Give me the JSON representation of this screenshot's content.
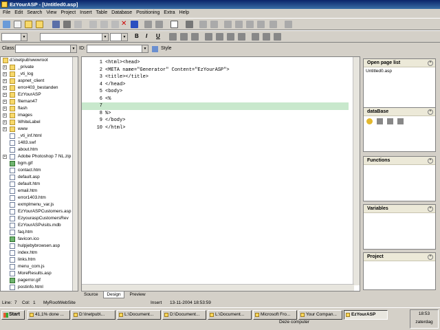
{
  "window": {
    "title": "EzYourASP - [Untitled0.asp]"
  },
  "menu": [
    "File",
    "Edit",
    "Search",
    "View",
    "Project",
    "Insert",
    "Table",
    "Database",
    "Positioning",
    "Extra",
    "Help"
  ],
  "classbar": {
    "class_label": "Class:",
    "id_label": "ID:",
    "style_label": "Style"
  },
  "tree": {
    "root": "d:\\inetpub\\wwwroot",
    "items": [
      {
        "label": "_private",
        "type": "folder",
        "expandable": true
      },
      {
        "label": "_vti_log",
        "type": "folder",
        "expandable": true
      },
      {
        "label": "aspnet_client",
        "type": "folder",
        "expandable": true
      },
      {
        "label": "error403_bestanden",
        "type": "folder",
        "expandable": true
      },
      {
        "label": "EzYourASP",
        "type": "folder",
        "expandable": true
      },
      {
        "label": "fileman47",
        "type": "folder",
        "expandable": true
      },
      {
        "label": "flash",
        "type": "folder",
        "expandable": true
      },
      {
        "label": "images",
        "type": "folder",
        "expandable": true
      },
      {
        "label": "WhiteLabel",
        "type": "folder",
        "expandable": true
      },
      {
        "label": "www",
        "type": "folder",
        "expandable": true
      },
      {
        "label": "_vti_inf.html",
        "type": "file",
        "expandable": false
      },
      {
        "label": "1483.swf",
        "type": "file",
        "expandable": false
      },
      {
        "label": "about.htm",
        "type": "file",
        "expandable": false
      },
      {
        "label": "Adobe Photoshop 7 NL.zip",
        "type": "file",
        "expandable": true
      },
      {
        "label": "bgm.gif",
        "type": "img",
        "expandable": false
      },
      {
        "label": "contact.htm",
        "type": "file",
        "expandable": false
      },
      {
        "label": "default.asp",
        "type": "file",
        "expandable": false
      },
      {
        "label": "default.htm",
        "type": "file",
        "expandable": false
      },
      {
        "label": "email.htm",
        "type": "file",
        "expandable": false
      },
      {
        "label": "error1403.htm",
        "type": "file",
        "expandable": false
      },
      {
        "label": "exmplmenu_var.js",
        "type": "file",
        "expandable": false
      },
      {
        "label": "EzYourASPCustomers.asp",
        "type": "file",
        "expandable": false
      },
      {
        "label": "EzyouraspCustomersRev",
        "type": "file",
        "expandable": false
      },
      {
        "label": "EzYourASPvisits.mdb",
        "type": "file",
        "expandable": false
      },
      {
        "label": "faq.htm",
        "type": "file",
        "expandable": false
      },
      {
        "label": "favicon.ico",
        "type": "img",
        "expandable": false
      },
      {
        "label": "hulpjebybrowsen.asp",
        "type": "file",
        "expandable": false
      },
      {
        "label": "index.htm",
        "type": "file",
        "expandable": false
      },
      {
        "label": "links.htm",
        "type": "file",
        "expandable": false
      },
      {
        "label": "menu_com.js",
        "type": "file",
        "expandable": false
      },
      {
        "label": "MoreResults.asp",
        "type": "file",
        "expandable": false
      },
      {
        "label": "pagerror.gif",
        "type": "img",
        "expandable": false
      },
      {
        "label": "postinfo.html",
        "type": "file",
        "expandable": false
      }
    ]
  },
  "editor": {
    "lines": [
      {
        "n": "1",
        "text": "<html><head>"
      },
      {
        "n": "2",
        "text": "<META name=\"Generator\" Content=\"EzYourASP\">"
      },
      {
        "n": "3",
        "text": "<title></title>"
      },
      {
        "n": "4",
        "text": "</head>"
      },
      {
        "n": "5",
        "text": "<body>"
      },
      {
        "n": "6",
        "text": "<%"
      },
      {
        "n": "7",
        "text": ""
      },
      {
        "n": "8",
        "text": "%>"
      },
      {
        "n": "9",
        "text": "</body>"
      },
      {
        "n": "10",
        "text": "</html>"
      }
    ],
    "highlight_line": 7,
    "tabs": [
      "Source",
      "Design",
      "Preview"
    ],
    "active_tab": "Design"
  },
  "panels": [
    {
      "title": "Open page list",
      "items": [
        "Untitled0.asp"
      ]
    },
    {
      "title": "dataBase",
      "items": []
    },
    {
      "title": "Functions",
      "items": []
    },
    {
      "title": "Variables",
      "items": []
    },
    {
      "title": "Project",
      "items": []
    }
  ],
  "status": {
    "line": "Line:",
    "line_val": "7",
    "col": "Col:",
    "col_val": "1",
    "root": "MyRootWebSite",
    "mode": "Insert",
    "datetime": "13-11-2004 18:53:59"
  },
  "taskbar": {
    "start": "Start",
    "tasks": [
      {
        "label": "41,1% done ...",
        "active": false
      },
      {
        "label": "D:\\Inetpub\\...",
        "active": false
      },
      {
        "label": "L:\\Document...",
        "active": false
      },
      {
        "label": "D:\\Document...",
        "active": false
      },
      {
        "label": "L:\\Document...",
        "active": false
      },
      {
        "label": "Microsoft Fro...",
        "active": false
      },
      {
        "label": "Your Compan...",
        "active": false
      },
      {
        "label": "EzYourASP",
        "active": true
      }
    ],
    "desktop_label": "Deze computer",
    "clock": "18:53",
    "day": "zaterdag"
  },
  "colors": {
    "titlebar": "#0a246a",
    "highlight_line": "#c8e8cc",
    "tag": "#000080",
    "string": "#a00000"
  }
}
